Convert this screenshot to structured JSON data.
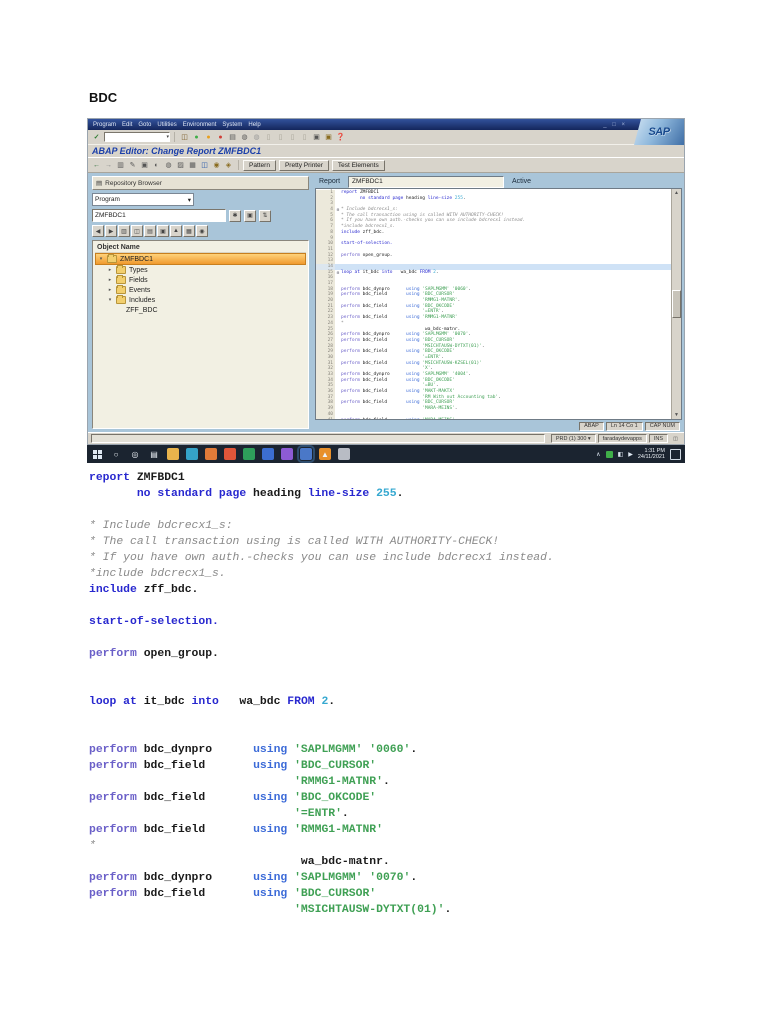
{
  "page": {
    "heading": "BDC"
  },
  "colors": {
    "sap_menubar": "#1c3576",
    "content_bg": "#a9c5d9",
    "tree_selected": "#f0a43c",
    "taskbar_bg": "#1b2430",
    "keyword": "#2828cf",
    "string": "#3fa054",
    "comment": "#8a8a8a",
    "number": "#35a8d0",
    "highlight_line_bg": "#cfe2f6"
  },
  "sap_window": {
    "menu_items": [
      "Program",
      "Edit",
      "Goto",
      "Utilities",
      "Environment",
      "System",
      "Help"
    ],
    "window_controls": "_ □ ×",
    "logo_text": "SAP",
    "title": "ABAP Editor: Change Report ZMFBDC1",
    "std_toolbar_icons": [
      {
        "name": "save-icon",
        "glyph": "◫",
        "fg": "#7a5c28"
      },
      {
        "name": "back-icon",
        "glyph": "●",
        "fg": "#3fae49"
      },
      {
        "name": "exit-icon",
        "glyph": "●",
        "fg": "#e8a020"
      },
      {
        "name": "cancel-icon",
        "glyph": "●",
        "fg": "#d04038"
      },
      {
        "name": "print-icon",
        "glyph": "▤",
        "fg": "#555555"
      },
      {
        "name": "find-icon",
        "glyph": "◍",
        "fg": "#555555"
      },
      {
        "name": "find-next-icon",
        "glyph": "◍",
        "fg": "#999999"
      },
      {
        "name": "first-page-icon",
        "glyph": "▯",
        "fg": "#a8a49a"
      },
      {
        "name": "prev-page-icon",
        "glyph": "▯",
        "fg": "#a8a49a"
      },
      {
        "name": "next-page-icon",
        "glyph": "▯",
        "fg": "#a8a49a"
      },
      {
        "name": "last-page-icon",
        "glyph": "▯",
        "fg": "#a8a49a"
      },
      {
        "name": "new-session-icon",
        "glyph": "▣",
        "fg": "#555555"
      },
      {
        "name": "shortcut-icon",
        "glyph": "▣",
        "fg": "#8a6c20"
      },
      {
        "name": "help-icon",
        "glyph": "❓",
        "fg": "#b8860b"
      }
    ],
    "app_toolbar_icons": [
      {
        "name": "back-arrow-icon",
        "glyph": "←",
        "fg": "#2e6e3a"
      },
      {
        "name": "forward-arrow-icon",
        "glyph": "→",
        "fg": "#888888"
      },
      {
        "name": "other-object-icon",
        "glyph": "▥",
        "fg": "#555555"
      },
      {
        "name": "display-change-icon",
        "glyph": "✎",
        "fg": "#555555"
      },
      {
        "name": "test-icon",
        "glyph": "▣",
        "fg": "#555555"
      },
      {
        "name": "refresh-icon",
        "glyph": "◐",
        "fg": "#555555"
      },
      {
        "name": "check-icon",
        "glyph": "◍",
        "fg": "#555555"
      },
      {
        "name": "activate-icon",
        "glyph": "▨",
        "fg": "#555555"
      },
      {
        "name": "where-used-icon",
        "glyph": "▦",
        "fg": "#555555"
      },
      {
        "name": "hierarchy-icon",
        "glyph": "◫",
        "fg": "#2255aa"
      },
      {
        "name": "info-icon",
        "glyph": "◉",
        "fg": "#8a6c20"
      },
      {
        "name": "docs-icon",
        "glyph": "◈",
        "fg": "#8a6c20"
      }
    ],
    "toolbar_buttons": [
      "Pattern",
      "Pretty Printer",
      "Test Elements"
    ],
    "left_panel": {
      "header": "Repository Browser",
      "header_icon": "repository-icon",
      "object_type": "Program",
      "object_value": "ZMFBDC1",
      "field_buttons": [
        {
          "name": "matchcode-icon",
          "glyph": "✱"
        },
        {
          "name": "display-icon",
          "glyph": "▣"
        },
        {
          "name": "refresh-tree-icon",
          "glyph": "⇅"
        }
      ],
      "mini_toolbar_icons": [
        "◀",
        "▶",
        "▥",
        "◫",
        "▤",
        "▣",
        "▲",
        "▦",
        "◉"
      ],
      "tree_header": "Object Name",
      "tree": [
        {
          "label": "ZMFBDC1",
          "level": 0,
          "exp": "open",
          "icon": "folder",
          "selected": true
        },
        {
          "label": "Types",
          "level": 1,
          "exp": "closed",
          "icon": "folder",
          "selected": false
        },
        {
          "label": "Fields",
          "level": 1,
          "exp": "closed",
          "icon": "folder",
          "selected": false
        },
        {
          "label": "Events",
          "level": 1,
          "exp": "closed",
          "icon": "folder",
          "selected": false
        },
        {
          "label": "Includes",
          "level": 1,
          "exp": "open",
          "icon": "folder",
          "selected": false
        },
        {
          "label": "ZFF_BDC",
          "level": 2,
          "exp": "none",
          "icon": "none",
          "selected": false
        }
      ]
    },
    "editor": {
      "header_label": "Report",
      "header_value": "ZMFBDC1",
      "header_status": "Active",
      "highlight_line": 14,
      "fold_lines": [
        4,
        15
      ],
      "status_cells": [
        "ABAP",
        "Ln 14 Co 1",
        "CAP NUM"
      ]
    },
    "status_right_cells": [
      "PRD (1) 300",
      "faradaydevapps",
      "INS"
    ]
  },
  "code": {
    "doc_line_count": 28,
    "lines": [
      [
        [
          "k",
          "report"
        ],
        [
          "t",
          " ZMFBDC1"
        ]
      ],
      [
        [
          "k",
          "       no standard page"
        ],
        [
          "t",
          " heading"
        ],
        [
          "k",
          " line-size"
        ],
        [
          "n",
          " 255"
        ],
        [
          "t",
          "."
        ]
      ],
      [],
      [
        [
          "c",
          "* Include bdcrecx1_s:"
        ]
      ],
      [
        [
          "c",
          "* The call transaction using is called WITH AUTHORITY-CHECK!"
        ]
      ],
      [
        [
          "c",
          "* If you have own auth.-checks you can use include bdcrecx1 instead."
        ]
      ],
      [
        [
          "c",
          "*include bdcrecx1_s."
        ]
      ],
      [
        [
          "k",
          "include"
        ],
        [
          "t",
          " zff_bdc."
        ]
      ],
      [],
      [
        [
          "k",
          "start-of-selection."
        ]
      ],
      [],
      [
        [
          "p",
          "perform"
        ],
        [
          "t",
          " open_group."
        ]
      ],
      [],
      [],
      [
        [
          "k",
          "loop at"
        ],
        [
          "t",
          " it_bdc"
        ],
        [
          "k",
          " into"
        ],
        [
          "t",
          "   wa_bdc"
        ],
        [
          "k",
          " FROM"
        ],
        [
          "n",
          " 2"
        ],
        [
          "t",
          "."
        ]
      ],
      [],
      [],
      [
        [
          "p",
          "perform"
        ],
        [
          "t",
          " bdc_dynpro      "
        ],
        [
          "u",
          "using"
        ],
        [
          "s",
          " 'SAPLMGMM' '0060'"
        ],
        [
          "t",
          "."
        ]
      ],
      [
        [
          "p",
          "perform"
        ],
        [
          "t",
          " bdc_field       "
        ],
        [
          "u",
          "using"
        ],
        [
          "s",
          " 'BDC_CURSOR'"
        ]
      ],
      [
        [
          "s",
          "                              'RMMG1-MATNR'"
        ],
        [
          "t",
          "."
        ]
      ],
      [
        [
          "p",
          "perform"
        ],
        [
          "t",
          " bdc_field       "
        ],
        [
          "u",
          "using"
        ],
        [
          "s",
          " 'BDC_OKCODE'"
        ]
      ],
      [
        [
          "s",
          "                              '=ENTR'"
        ],
        [
          "t",
          "."
        ]
      ],
      [
        [
          "p",
          "perform"
        ],
        [
          "t",
          " bdc_field       "
        ],
        [
          "u",
          "using"
        ],
        [
          "s",
          " 'RMMG1-MATNR'"
        ]
      ],
      [
        [
          "c",
          "*"
        ]
      ],
      [
        [
          "t",
          "                               wa_bdc-matnr."
        ]
      ],
      [
        [
          "p",
          "perform"
        ],
        [
          "t",
          " bdc_dynpro      "
        ],
        [
          "u",
          "using"
        ],
        [
          "s",
          " 'SAPLMGMM' '0070'"
        ],
        [
          "t",
          "."
        ]
      ],
      [
        [
          "p",
          "perform"
        ],
        [
          "t",
          " bdc_field       "
        ],
        [
          "u",
          "using"
        ],
        [
          "s",
          " 'BDC_CURSOR'"
        ]
      ],
      [
        [
          "s",
          "                              'MSICHTAUSW-DYTXT(01)'"
        ],
        [
          "t",
          "."
        ]
      ],
      [
        [
          "p",
          "perform"
        ],
        [
          "t",
          " bdc_field       "
        ],
        [
          "u",
          "using"
        ],
        [
          "s",
          " 'BDC_OKCODE'"
        ]
      ],
      [
        [
          "s",
          "                              '=ENTR'"
        ],
        [
          "t",
          "."
        ]
      ],
      [
        [
          "p",
          "perform"
        ],
        [
          "t",
          " bdc_field       "
        ],
        [
          "u",
          "using"
        ],
        [
          "s",
          " 'MSICHTAUSW-KZSEL(01)'"
        ]
      ],
      [
        [
          "s",
          "                              'X'"
        ],
        [
          "t",
          "."
        ]
      ],
      [
        [
          "p",
          "perform"
        ],
        [
          "t",
          " bdc_dynpro      "
        ],
        [
          "u",
          "using"
        ],
        [
          "s",
          " 'SAPLMGMM' '4004'"
        ],
        [
          "t",
          "."
        ]
      ],
      [
        [
          "p",
          "perform"
        ],
        [
          "t",
          " bdc_field       "
        ],
        [
          "u",
          "using"
        ],
        [
          "s",
          " 'BDC_OKCODE'"
        ]
      ],
      [
        [
          "s",
          "                              '=BU'"
        ],
        [
          "t",
          "."
        ]
      ],
      [
        [
          "p",
          "perform"
        ],
        [
          "t",
          " bdc_field       "
        ],
        [
          "u",
          "using"
        ],
        [
          "s",
          " 'MAKT-MAKTX'"
        ]
      ],
      [
        [
          "s",
          "                              'RM With out Accounting tab'"
        ],
        [
          "t",
          "."
        ]
      ],
      [
        [
          "p",
          "perform"
        ],
        [
          "t",
          " bdc_field       "
        ],
        [
          "u",
          "using"
        ],
        [
          "s",
          " 'BDC_CURSOR'"
        ]
      ],
      [
        [
          "s",
          "                              'MARA-MEINS'"
        ],
        [
          "t",
          "."
        ]
      ],
      [],
      [
        [
          "p",
          "perform"
        ],
        [
          "t",
          " bdc_field       "
        ],
        [
          "u",
          "using"
        ],
        [
          "s",
          " 'MARA-MEINS'"
        ]
      ]
    ]
  },
  "taskbar": {
    "icons": [
      {
        "name": "search-icon",
        "glyph": "○",
        "color": "transparent"
      },
      {
        "name": "cortana-icon",
        "glyph": "◎",
        "color": "transparent"
      },
      {
        "name": "task-view-icon",
        "glyph": "▤",
        "color": "transparent"
      },
      {
        "name": "file-explorer-icon",
        "glyph": "",
        "color": "#e9b44c"
      },
      {
        "name": "edge-icon",
        "glyph": "",
        "color": "#35a3c8"
      },
      {
        "name": "app-window-icon",
        "glyph": "",
        "color": "#e07b39"
      },
      {
        "name": "firefox-icon",
        "glyph": "",
        "color": "#e1563a"
      },
      {
        "name": "excel-icon",
        "glyph": "",
        "color": "#2e9e5b"
      },
      {
        "name": "word-icon",
        "glyph": "",
        "color": "#3c6ed0"
      },
      {
        "name": "app-purple-icon",
        "glyph": "",
        "color": "#8d5bd4"
      },
      {
        "name": "sap-logon-icon",
        "glyph": "",
        "color": "#4a78c8",
        "active": true
      },
      {
        "name": "vlc-icon",
        "glyph": "▲",
        "color": "#e8902a"
      },
      {
        "name": "app-gray-icon",
        "glyph": "",
        "color": "#b8bcc4"
      }
    ],
    "tray_chevron": "∧",
    "time": "1:31 PM",
    "date": "24/11/2021"
  }
}
